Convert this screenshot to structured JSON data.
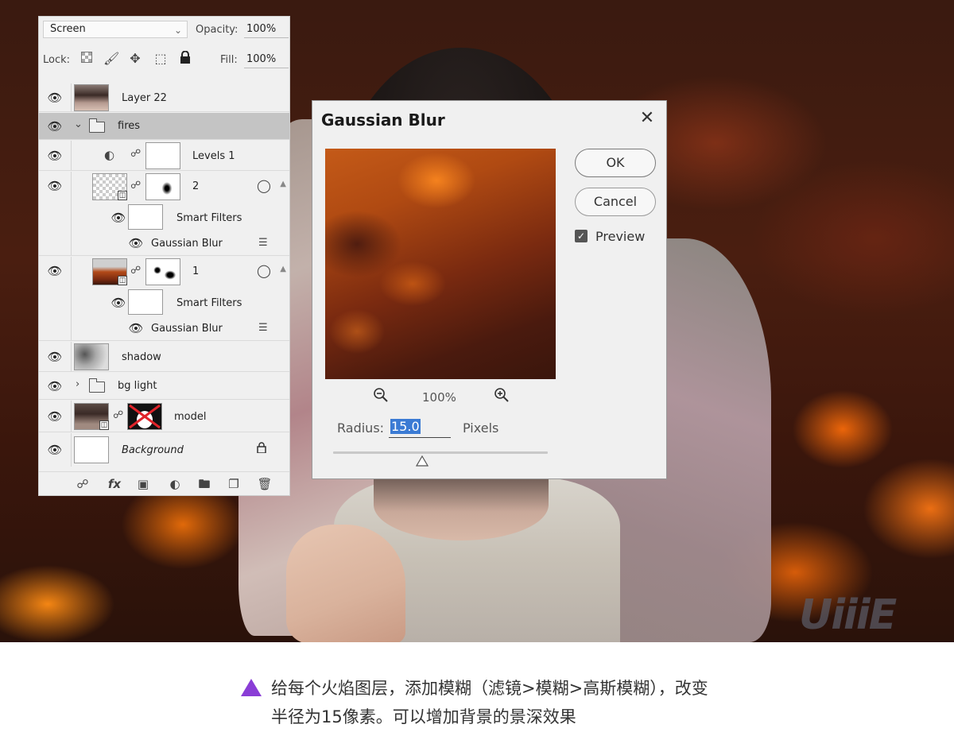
{
  "layers_panel": {
    "blend_mode": "Screen",
    "opacity_label": "Opacity:",
    "opacity_value": "100%",
    "lock_label": "Lock:",
    "fill_label": "Fill:",
    "fill_value": "100%",
    "layers": {
      "layer22": "Layer 22",
      "fires_group": "fires",
      "levels": "Levels 1",
      "fire2": "2",
      "smart_filters_2": "Smart Filters",
      "gaussian_blur_2": "Gaussian Blur",
      "fire1": "1",
      "smart_filters_1": "Smart Filters",
      "gaussian_blur_1": "Gaussian Blur",
      "shadow": "shadow",
      "bg_light_group": "bg light",
      "model": "model",
      "background": "Background"
    },
    "bottom_fx_label": "fx"
  },
  "dialog": {
    "title": "Gaussian Blur",
    "ok_label": "OK",
    "cancel_label": "Cancel",
    "preview_label": "Preview",
    "preview_checked": true,
    "zoom_value": "100%",
    "radius_label": "Radius:",
    "radius_value": "15.0",
    "radius_unit": "Pixels"
  },
  "watermark": "UiiiE",
  "caption": {
    "line1": "给每个火焰图层，添加模糊（滤镜>模糊>高斯模糊），改变",
    "line2": "半径为15像素。可以增加背景的景深效果",
    "marker_color": "#8a3dd6"
  },
  "icons": {
    "eye": "eye-icon",
    "lock": "lock-icon",
    "folder": "folder-icon",
    "chain": "chain-link-icon",
    "zoom_out": "zoom-out-icon",
    "zoom_in": "zoom-in-icon",
    "close": "close-icon"
  }
}
